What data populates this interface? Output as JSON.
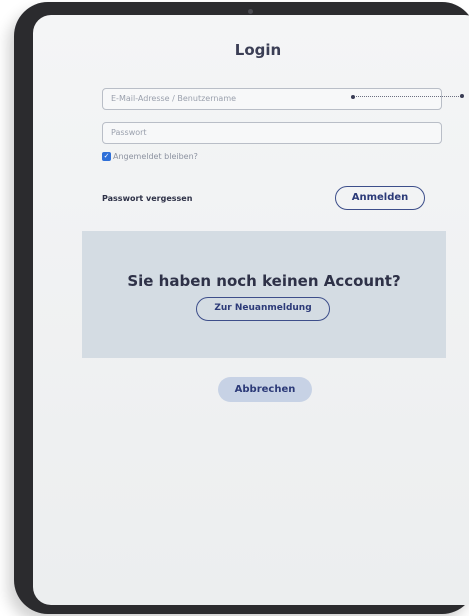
{
  "login": {
    "title": "Login",
    "email_placeholder": "E-Mail-Adresse / Benutzername",
    "password_placeholder": "Passwort",
    "remember_label": "Angemeldet bleiben?",
    "remember_checked": true,
    "forgot_label": "Passwort vergessen",
    "submit_label": "Anmelden"
  },
  "signup": {
    "title": "Sie haben noch keinen Account?",
    "button_label": "Zur Neuanmeldung"
  },
  "cancel_label": "Abbrechen",
  "colors": {
    "accent": "#2e6fd8",
    "button_border": "#3d4e8a",
    "signup_bg": "#d4dce3",
    "cancel_bg": "#c7d2e5"
  }
}
